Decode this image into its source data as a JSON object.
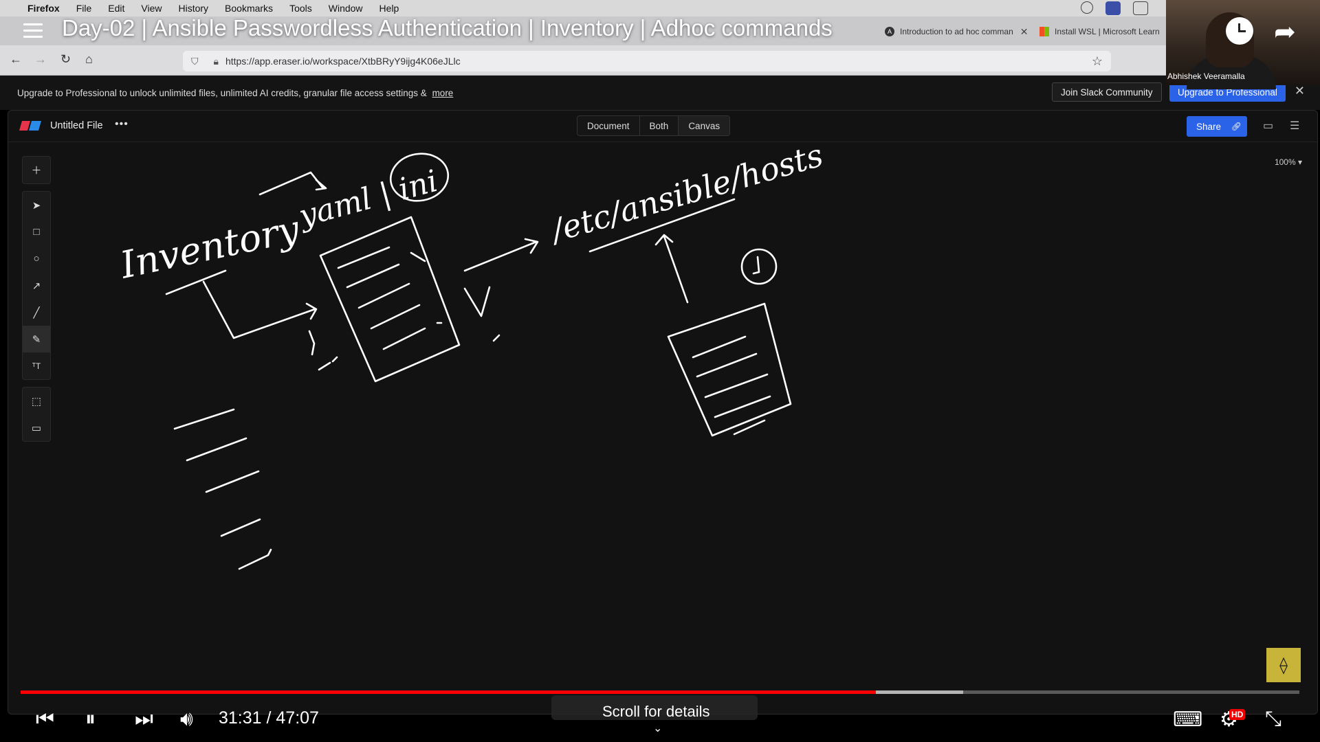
{
  "menubar": {
    "app": "Firefox",
    "items": [
      "File",
      "Edit",
      "View",
      "History",
      "Bookmarks",
      "Tools",
      "Window",
      "Help"
    ]
  },
  "tabs": {
    "tab1": "Introduction to ad hoc comman",
    "tab2": "Install WSL | Microsoft Learn"
  },
  "toolbar": {
    "url": "https://app.eraser.io/workspace/XtbBRyY9ijg4K06eJLlc"
  },
  "banner": {
    "text": "Upgrade to Professional to unlock unlimited files, unlimited AI credits, granular file access settings &",
    "more": "more",
    "slack_button": "Join Slack Community",
    "upgrade_button": "Upgrade to Professional"
  },
  "app": {
    "file_name": "Untitled File",
    "view_modes": [
      "Document",
      "Both",
      "Canvas"
    ],
    "share_label": "Share",
    "zoom": "100%"
  },
  "canvas_text": {
    "inventory": "Inventory",
    "formats": "yaml | ini",
    "path": "/etc/ansible/hosts"
  },
  "webcam": {
    "name": "Abhishek Veeramalla"
  },
  "youtube": {
    "title": "Day-02 | Ansible Passwordless Authentication | Inventory | Adhoc commands",
    "time": "31:31 / 47:07",
    "progress": 0.669,
    "buffered": 0.737,
    "scroll_hint": "Scroll for details",
    "hd": "HD"
  },
  "colors": {
    "progress": "#ff0000",
    "accent": "#2a62e8"
  }
}
